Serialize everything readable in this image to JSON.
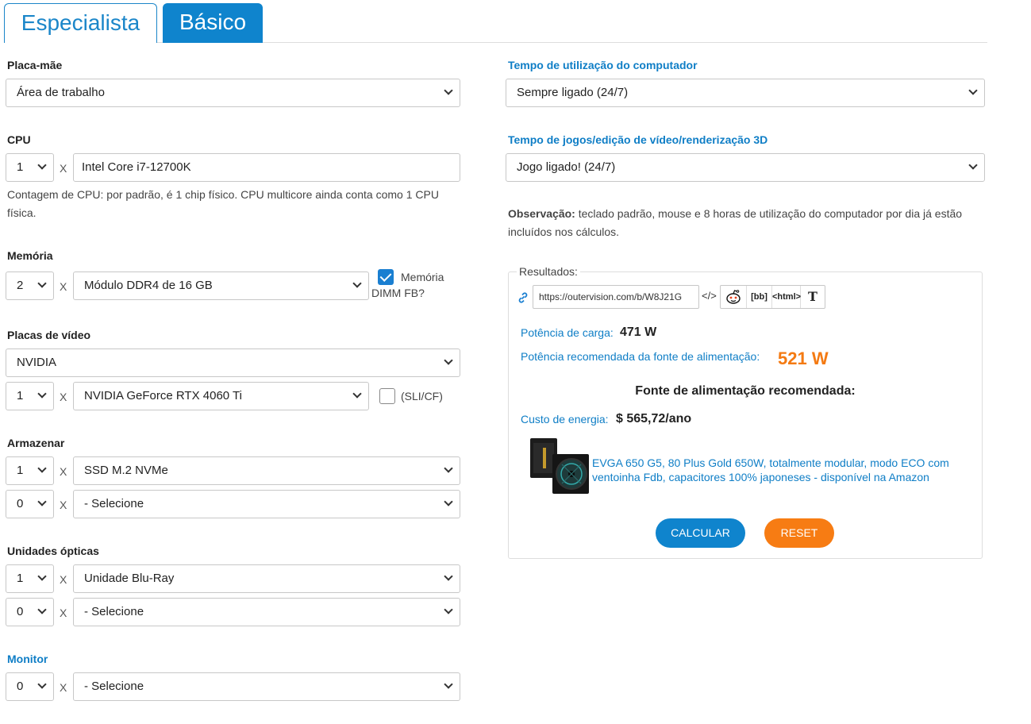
{
  "tabs": {
    "expert": "Especialista",
    "basic": "Básico"
  },
  "motherboard": {
    "label": "Placa-mãe",
    "value": "Área de trabalho"
  },
  "cpu": {
    "label": "CPU",
    "qty": "1",
    "x": "X",
    "value": "Intel Core i7-12700K",
    "note": "Contagem de CPU: por padrão, é 1 chip físico. CPU multicore ainda conta como 1 CPU física."
  },
  "memory": {
    "label": "Memória",
    "qty": "2",
    "x": "X",
    "value": "Módulo DDR4 de 16 GB",
    "fb_dimm_label": "Memória DIMM FB?",
    "fb_dimm_checked": true
  },
  "gpu": {
    "label": "Placas de vídeo",
    "brand": "NVIDIA",
    "qty": "1",
    "x": "X",
    "value": "NVIDIA GeForce RTX 4060 Ti",
    "sli_label": "(SLI/CF)",
    "sli_checked": false
  },
  "storage": {
    "label": "Armazenar",
    "rows": [
      {
        "qty": "1",
        "x": "X",
        "value": "SSD M.2 NVMe"
      },
      {
        "qty": "0",
        "x": "X",
        "value": "- Selecione"
      }
    ]
  },
  "optical": {
    "label": "Unidades ópticas",
    "rows": [
      {
        "qty": "1",
        "x": "X",
        "value": "Unidade Blu-Ray"
      },
      {
        "qty": "0",
        "x": "X",
        "value": "- Selecione"
      }
    ]
  },
  "monitor": {
    "label": "Monitor",
    "qty": "0",
    "x": "X",
    "value": "- Selecione"
  },
  "usage": {
    "label": "Tempo de utilização do computador",
    "value": "Sempre ligado (24/7)"
  },
  "gaming": {
    "label": "Tempo de jogos/edição de vídeo/renderização 3D",
    "value": "Jogo ligado! (24/7)"
  },
  "observation": {
    "bold": "Observação:",
    "text": " teclado padrão, mouse e 8 horas de utilização do computador por dia já estão incluídos nos cálculos."
  },
  "results": {
    "legend": "Resultados:",
    "share_url": "https://outervision.com/b/W8J21G",
    "share_buttons": [
      "</>",
      "reddit",
      "[bb]",
      "<html>",
      "T"
    ],
    "load_label": "Potência de carga:",
    "load_value": "471 W",
    "psu_label": "Potência recomendada da fonte de alimentação:",
    "psu_value": "521 W",
    "rec_title": "Fonte de alimentação recomendada:",
    "cost_label": "Custo de energia:",
    "cost_value": "$ 565,72/ano",
    "product": "EVGA 650 G5, 80 Plus Gold 650W, totalmente modular, modo ECO com ventoinha Fdb, capacitores 100% japoneses - disponível na Amazon"
  },
  "buttons": {
    "calculate": "CALCULAR",
    "reset": "RESET"
  },
  "colors": {
    "primary": "#0f84cd",
    "accent": "#f77c13",
    "result_highlight": "#f47a12"
  }
}
